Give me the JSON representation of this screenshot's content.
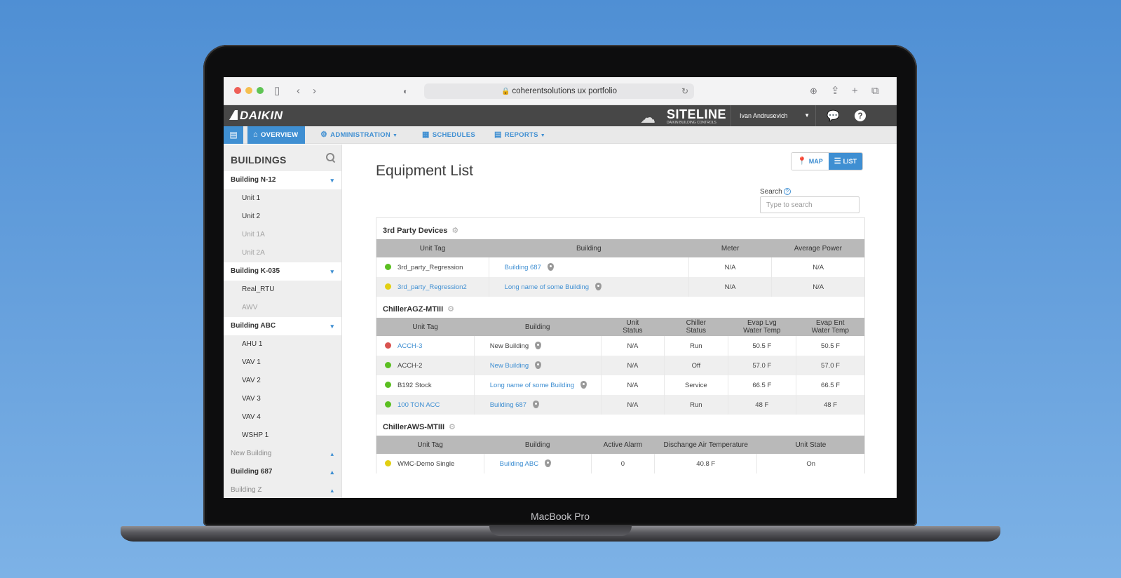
{
  "browser": {
    "url": "coherentsolutions ux portfolio",
    "traffic_colors": [
      "#ee5f57",
      "#f5bf4f",
      "#5fc454"
    ]
  },
  "laptop": {
    "label": "MacBook Pro"
  },
  "header": {
    "logo": "DAIKIN",
    "product": "SITELINE",
    "product_tag": "DAIKIN BUILDING CONTROLS",
    "user": "Ivan Andrusevich",
    "help": "?"
  },
  "nav": {
    "overview": "OVERVIEW",
    "administration": "ADMINISTRATION",
    "schedules": "SCHEDULES",
    "reports": "REPORTS"
  },
  "sidebar": {
    "title": "BUILDINGS",
    "rows": [
      {
        "type": "group",
        "label": "Building N-12",
        "chevron": "down"
      },
      {
        "type": "unit",
        "label": "Unit 1"
      },
      {
        "type": "unit",
        "label": "Unit 2"
      },
      {
        "type": "unit-dim",
        "label": "Unit 1A"
      },
      {
        "type": "unit-dim",
        "label": "Unit 2A"
      },
      {
        "type": "group",
        "label": "Building K-035",
        "chevron": "down"
      },
      {
        "type": "unit",
        "label": "Real_RTU"
      },
      {
        "type": "unit-dim",
        "label": "AWV"
      },
      {
        "type": "group",
        "label": "Building ABC",
        "chevron": "down"
      },
      {
        "type": "unit",
        "label": "AHU 1"
      },
      {
        "type": "unit",
        "label": "VAV 1"
      },
      {
        "type": "unit",
        "label": "VAV 2"
      },
      {
        "type": "unit",
        "label": "VAV 3"
      },
      {
        "type": "unit",
        "label": "VAV 4"
      },
      {
        "type": "unit",
        "label": "WSHP 1"
      },
      {
        "type": "group-muted",
        "label": "New Building",
        "chevron": "up"
      },
      {
        "type": "group-plain",
        "label": "Building 687",
        "chevron": "up"
      },
      {
        "type": "group-muted",
        "label": "Building Z",
        "chevron": "up"
      }
    ]
  },
  "main": {
    "title": "Equipment List",
    "view_toggle": {
      "map": "MAP",
      "list": "LIST"
    },
    "search": {
      "label": "Search",
      "placeholder": "Type to search"
    },
    "sections": [
      {
        "title": "3rd Party Devices",
        "columns": [
          "Unit Tag",
          "Building",
          "Meter",
          "Average Power"
        ],
        "rows": [
          {
            "status": "#5bbf21",
            "unit": "3rd_party_Regression",
            "unit_link": false,
            "building": "Building 687",
            "building_link": true,
            "cells": [
              "N/A",
              "N/A"
            ]
          },
          {
            "status": "#e2cf12",
            "unit": "3rd_party_Regression2",
            "unit_link": true,
            "building": "Long name of some Building",
            "building_link": true,
            "cells": [
              "N/A",
              "N/A"
            ]
          }
        ]
      },
      {
        "title": "ChillerAGZ-MTIII",
        "columns": [
          "Unit Tag",
          "Building",
          "Unit\nStatus",
          "Chiller\nStatus",
          "Evap Lvg\nWater Temp",
          "Evap Ent\nWater Temp"
        ],
        "rows": [
          {
            "status": "#d9534f",
            "unit": "ACCH-3",
            "unit_link": true,
            "building": "New Building",
            "building_link": false,
            "cells": [
              "N/A",
              "Run",
              "50.5 F",
              "50.5 F"
            ]
          },
          {
            "status": "#5bbf21",
            "unit": "ACCH-2",
            "unit_link": false,
            "building": "New Building",
            "building_link": true,
            "cells": [
              "N/A",
              "Off",
              "57.0 F",
              "57.0 F"
            ]
          },
          {
            "status": "#5bbf21",
            "unit": "B192 Stock",
            "unit_link": false,
            "building": "Long name of some  Building",
            "building_link": true,
            "cells": [
              "N/A",
              "Service",
              "66.5 F",
              "66.5 F"
            ]
          },
          {
            "status": "#5bbf21",
            "unit": "100 TON ACC",
            "unit_link": true,
            "building": "Building 687",
            "building_link": true,
            "cells": [
              "N/A",
              "Run",
              "48 F",
              "48 F"
            ]
          }
        ]
      },
      {
        "title": "ChillerAWS-MTIII",
        "columns": [
          "Unit Tag",
          "Building",
          "Active Alarm",
          "Dischange Air Temperature",
          "Unit State"
        ],
        "rows": [
          {
            "status": "#e2cf12",
            "unit": "WMC-Demo Single",
            "unit_link": false,
            "building": "Building ABC",
            "building_link": true,
            "cells": [
              "0",
              "40.8 F",
              "On"
            ]
          }
        ]
      }
    ]
  }
}
